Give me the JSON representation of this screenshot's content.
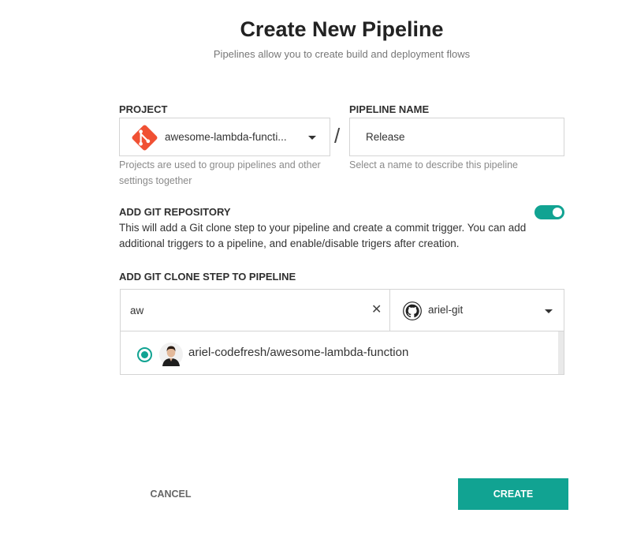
{
  "header": {
    "title": "Create New Pipeline",
    "subtitle": "Pipelines allow you to create build and deployment flows"
  },
  "project": {
    "label": "PROJECT",
    "value": "awesome-lambda-functi...",
    "help": "Projects are used to group pipelines and other settings together",
    "icon": "git-logo-icon"
  },
  "separator": "/",
  "pipeline_name": {
    "label": "PIPELINE NAME",
    "value": "Release",
    "help": "Select a name to describe this pipeline"
  },
  "git_repository": {
    "label": "ADD GIT REPOSITORY",
    "description": "This will add a Git clone step to your pipeline and create a commit trigger. You can add additional triggers to a pipeline, and enable/disable trigers after creation.",
    "enabled": true
  },
  "clone_step": {
    "label": "ADD GIT CLONE STEP TO PIPELINE",
    "search_value": "aw",
    "clear_symbol": "✕",
    "account": "ariel-git",
    "repositories": [
      {
        "name": "ariel-codefresh/awesome-lambda-function",
        "selected": true
      }
    ]
  },
  "actions": {
    "cancel": "CANCEL",
    "create": "CREATE"
  },
  "colors": {
    "accent": "#11a392",
    "git_brand": "#f05033"
  }
}
